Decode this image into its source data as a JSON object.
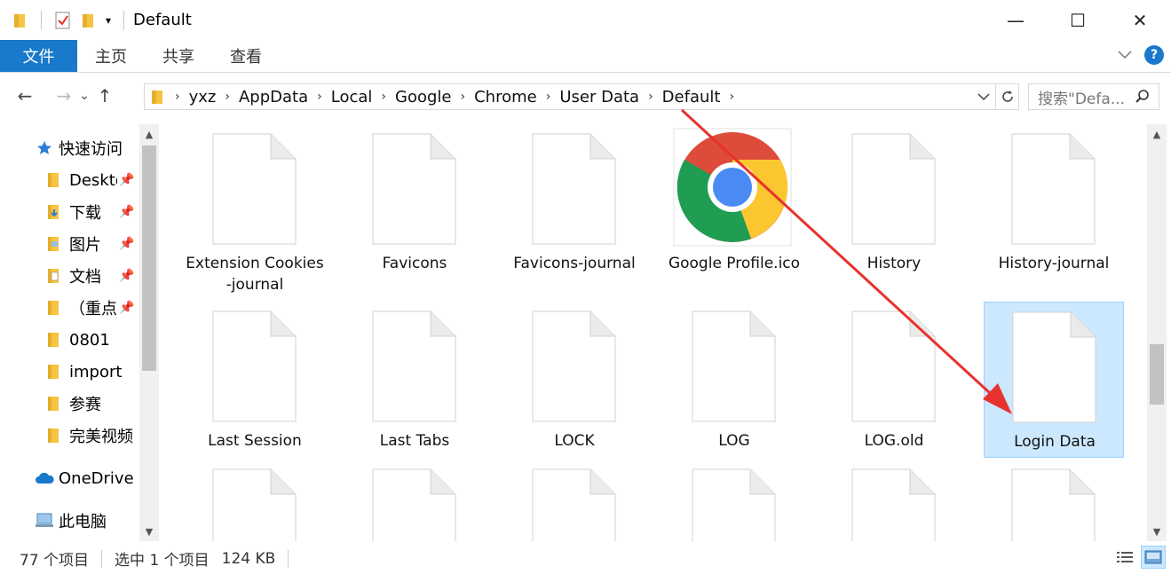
{
  "window": {
    "title": "Default",
    "minimize": "—",
    "maximize": "☐",
    "close": "✕"
  },
  "ribbon": {
    "tabs": [
      "文件",
      "主页",
      "共享",
      "查看"
    ]
  },
  "nav": {
    "back": "←",
    "forward": "→",
    "recent": "⌄",
    "up": "↑"
  },
  "address": {
    "crumbs": [
      "yxz",
      "AppData",
      "Local",
      "Google",
      "Chrome",
      "User Data",
      "Default"
    ],
    "search_placeholder": "搜索\"Defa..."
  },
  "sidebar": {
    "quick_access": "快速访问",
    "items": [
      {
        "label": "Desktop",
        "pinned": true
      },
      {
        "label": "下载",
        "pinned": true
      },
      {
        "label": "图片",
        "pinned": true
      },
      {
        "label": "文档",
        "pinned": true
      },
      {
        "label": "（重点",
        "pinned": true
      },
      {
        "label": "0801",
        "pinned": false
      },
      {
        "label": "import",
        "pinned": false
      },
      {
        "label": "参赛",
        "pinned": false
      },
      {
        "label": "完美视频",
        "pinned": false
      }
    ],
    "onedrive": "OneDrive",
    "this_pc": "此电脑"
  },
  "files": [
    {
      "name": "Extension Cookies-journal",
      "icon": "document-icon"
    },
    {
      "name": "Favicons",
      "icon": "document-icon"
    },
    {
      "name": "Favicons-journal",
      "icon": "document-icon"
    },
    {
      "name": "Google Profile.ico",
      "icon": "chrome-icon"
    },
    {
      "name": "History",
      "icon": "document-icon"
    },
    {
      "name": "History-journal",
      "icon": "document-icon"
    },
    {
      "name": "Last Session",
      "icon": "document-icon"
    },
    {
      "name": "Last Tabs",
      "icon": "document-icon"
    },
    {
      "name": "LOCK",
      "icon": "document-icon"
    },
    {
      "name": "LOG",
      "icon": "document-icon"
    },
    {
      "name": "LOG.old",
      "icon": "document-icon"
    },
    {
      "name": "Login Data",
      "icon": "document-icon",
      "selected": true
    },
    {
      "name": "",
      "icon": "document-icon"
    },
    {
      "name": "",
      "icon": "document-icon"
    },
    {
      "name": "",
      "icon": "document-icon"
    },
    {
      "name": "",
      "icon": "document-icon"
    },
    {
      "name": "",
      "icon": "document-icon"
    },
    {
      "name": "",
      "icon": "document-icon"
    }
  ],
  "status": {
    "count": "77 个项目",
    "selection": "选中 1 个项目",
    "size": "124 KB"
  },
  "colors": {
    "accent": "#1979ca",
    "selection": "#cce8ff",
    "annotation_arrow": "#e8322e"
  }
}
